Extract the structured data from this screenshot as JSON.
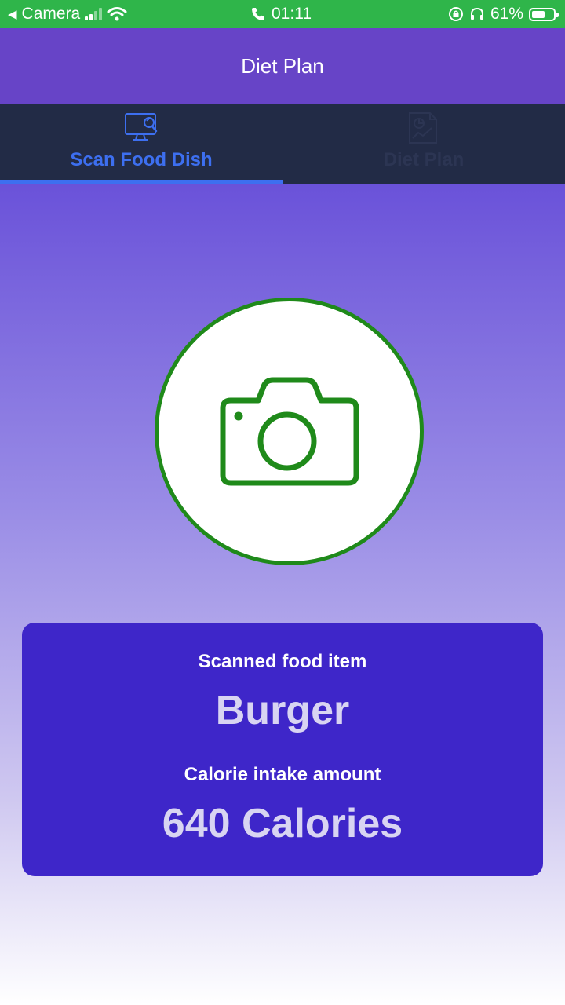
{
  "status_bar": {
    "back_app": "Camera",
    "time": "01:11",
    "battery": "61%",
    "battery_level": 0.61
  },
  "app_bar": {
    "title": "Diet Plan"
  },
  "tabs": [
    {
      "label": "Scan Food Dish",
      "icon": "monitor-search-icon",
      "active": true
    },
    {
      "label": "Diet Plan",
      "icon": "report-chart-icon",
      "active": false
    }
  ],
  "scan": {
    "icon": "camera-icon"
  },
  "result": {
    "food_label": "Scanned food item",
    "food_value": "Burger",
    "calorie_label": "Calorie intake amount",
    "calorie_value": "640 Calories"
  },
  "colors": {
    "status_bar": "#2fb54a",
    "app_bar": "#6744c7",
    "tab_bar": "#222b46",
    "tab_active": "#3d6ff0",
    "scan_ring": "#1f8a1a",
    "card": "#3e26c9"
  }
}
